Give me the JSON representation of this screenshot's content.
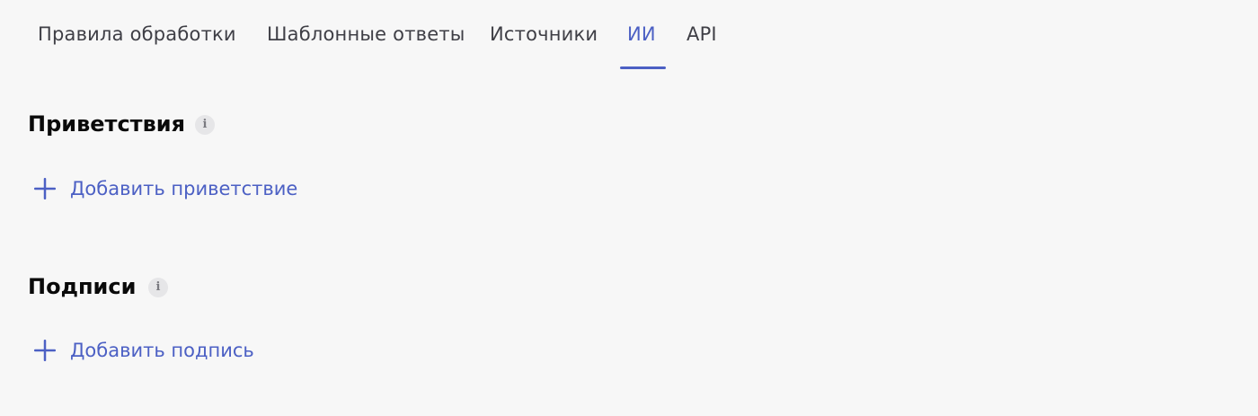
{
  "tabs": [
    {
      "label": "Правила обработки",
      "active": false
    },
    {
      "label": "Шаблонные ответы",
      "active": false
    },
    {
      "label": "Источники",
      "active": false
    },
    {
      "label": "ИИ",
      "active": true
    },
    {
      "label": "API",
      "active": false
    }
  ],
  "sections": {
    "greetings": {
      "title": "Приветствия",
      "info_icon": "info-icon",
      "add_label": "Добавить приветствие"
    },
    "signatures": {
      "title": "Подписи",
      "info_icon": "info-icon",
      "add_label": "Добавить подпись"
    }
  },
  "colors": {
    "accent": "#4c60c4",
    "background": "#f7f7f7",
    "text": "#3f3f46",
    "heading": "#0a0a0a"
  }
}
